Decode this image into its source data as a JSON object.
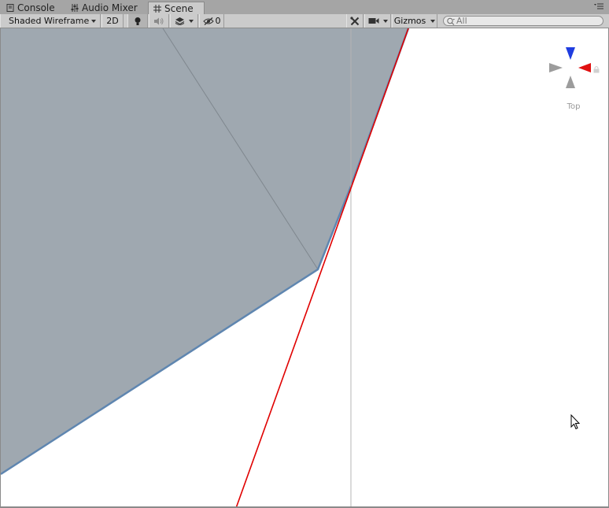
{
  "tabs": [
    {
      "label": "Console",
      "icon": "console-icon"
    },
    {
      "label": "Audio Mixer",
      "icon": "audio-mixer-icon"
    },
    {
      "label": "Scene",
      "icon": "scene-grid-icon",
      "active": true
    }
  ],
  "toolbar": {
    "draw_mode": "Shaded Wireframe",
    "mode_2d": "2D",
    "hidden_count": "0",
    "gizmos_label": "Gizmos",
    "search_placeholder": "All"
  },
  "scene": {
    "view_label": "Top"
  },
  "colors": {
    "tab_bar": "#a5a5a5",
    "toolbar": "#cbcbcb",
    "mesh_fill": "#9fa8b0",
    "mesh_edge": "#5f86b0",
    "red_line": "#e00000",
    "gizmo_y": "#1f3de0",
    "gizmo_x": "#e01010",
    "gizmo_neutral": "#9c9c9c"
  }
}
